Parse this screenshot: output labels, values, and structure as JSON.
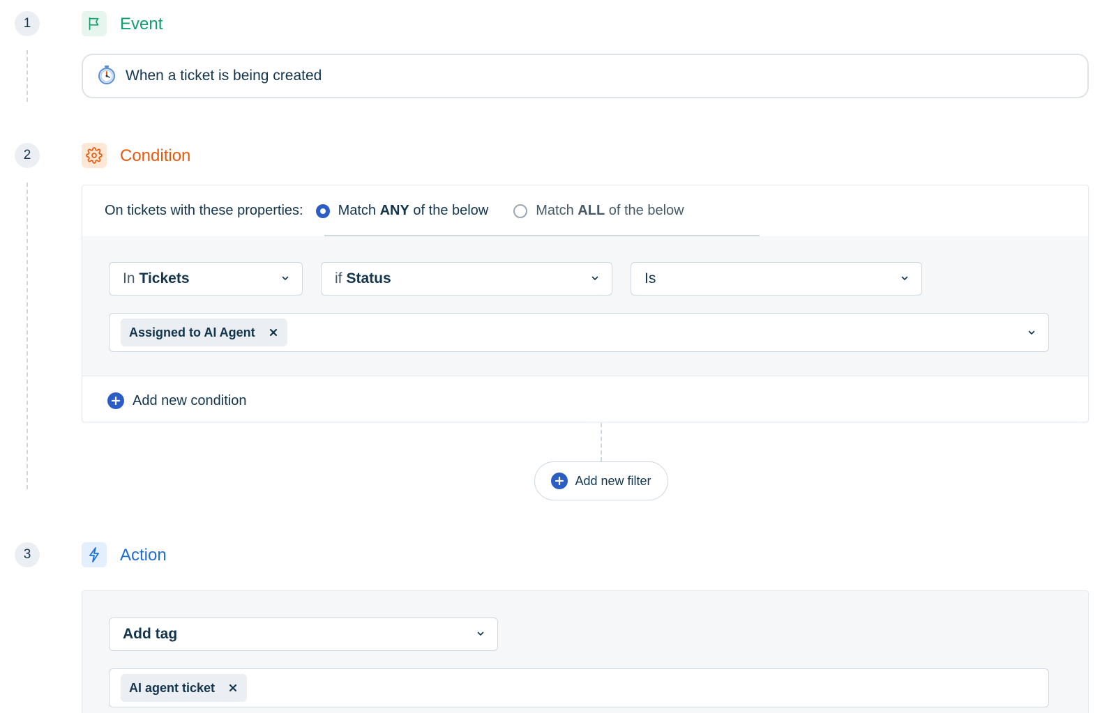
{
  "steps": [
    {
      "number": "1",
      "title": "Event",
      "color": "#0e9f6e",
      "icon_bg": "#e6f6ee",
      "icon": "flag-icon"
    },
    {
      "number": "2",
      "title": "Condition",
      "color": "#e8590c",
      "icon_bg": "#fde8d7",
      "icon": "gear-icon"
    },
    {
      "number": "3",
      "title": "Action",
      "color": "#1d6fd8",
      "icon_bg": "#e3efff",
      "icon": "lightning-icon"
    }
  ],
  "event": {
    "text": "When a ticket is being created",
    "icon": "stopwatch-icon"
  },
  "condition": {
    "lead": "On tickets with these properties:",
    "match_any": {
      "pre": "Match ",
      "bold": "ANY",
      "post": " of the below",
      "selected": true
    },
    "match_all": {
      "pre": "Match ",
      "bold": "ALL",
      "post": " of the below",
      "selected": false
    },
    "in_select": {
      "prefix": "In",
      "value": "Tickets"
    },
    "field_select": {
      "prefix": "if",
      "value": "Status"
    },
    "operator_select": {
      "value": "Is"
    },
    "value_chips": [
      {
        "label": "Assigned to AI Agent"
      }
    ],
    "add_condition": "Add new condition"
  },
  "add_filter": "Add new filter",
  "action": {
    "select": {
      "value": "Add tag"
    },
    "tag_chips": [
      {
        "label": "AI agent ticket"
      }
    ]
  },
  "colors": {
    "primary": "#2c5cc5",
    "text": "#12344d"
  }
}
